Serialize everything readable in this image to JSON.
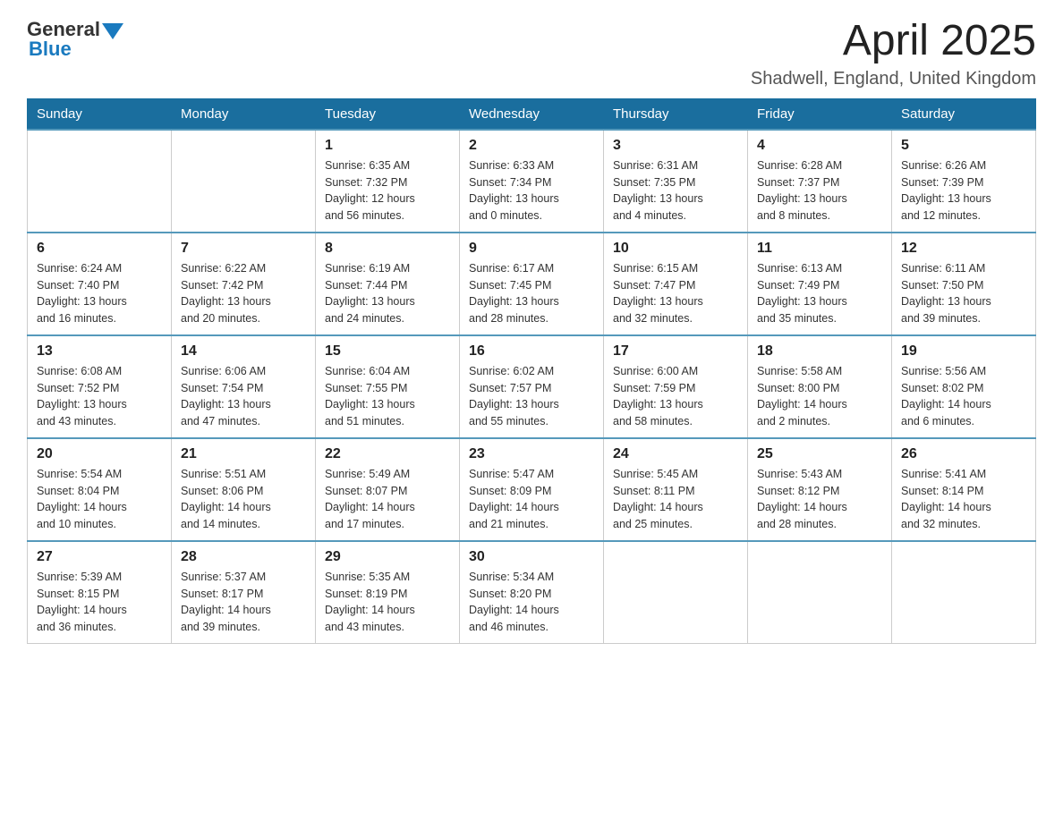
{
  "header": {
    "logo": {
      "general": "General",
      "blue": "Blue"
    },
    "title": "April 2025",
    "subtitle": "Shadwell, England, United Kingdom"
  },
  "calendar": {
    "days_of_week": [
      "Sunday",
      "Monday",
      "Tuesday",
      "Wednesday",
      "Thursday",
      "Friday",
      "Saturday"
    ],
    "weeks": [
      [
        {
          "day": "",
          "info": ""
        },
        {
          "day": "",
          "info": ""
        },
        {
          "day": "1",
          "info": "Sunrise: 6:35 AM\nSunset: 7:32 PM\nDaylight: 12 hours\nand 56 minutes."
        },
        {
          "day": "2",
          "info": "Sunrise: 6:33 AM\nSunset: 7:34 PM\nDaylight: 13 hours\nand 0 minutes."
        },
        {
          "day": "3",
          "info": "Sunrise: 6:31 AM\nSunset: 7:35 PM\nDaylight: 13 hours\nand 4 minutes."
        },
        {
          "day": "4",
          "info": "Sunrise: 6:28 AM\nSunset: 7:37 PM\nDaylight: 13 hours\nand 8 minutes."
        },
        {
          "day": "5",
          "info": "Sunrise: 6:26 AM\nSunset: 7:39 PM\nDaylight: 13 hours\nand 12 minutes."
        }
      ],
      [
        {
          "day": "6",
          "info": "Sunrise: 6:24 AM\nSunset: 7:40 PM\nDaylight: 13 hours\nand 16 minutes."
        },
        {
          "day": "7",
          "info": "Sunrise: 6:22 AM\nSunset: 7:42 PM\nDaylight: 13 hours\nand 20 minutes."
        },
        {
          "day": "8",
          "info": "Sunrise: 6:19 AM\nSunset: 7:44 PM\nDaylight: 13 hours\nand 24 minutes."
        },
        {
          "day": "9",
          "info": "Sunrise: 6:17 AM\nSunset: 7:45 PM\nDaylight: 13 hours\nand 28 minutes."
        },
        {
          "day": "10",
          "info": "Sunrise: 6:15 AM\nSunset: 7:47 PM\nDaylight: 13 hours\nand 32 minutes."
        },
        {
          "day": "11",
          "info": "Sunrise: 6:13 AM\nSunset: 7:49 PM\nDaylight: 13 hours\nand 35 minutes."
        },
        {
          "day": "12",
          "info": "Sunrise: 6:11 AM\nSunset: 7:50 PM\nDaylight: 13 hours\nand 39 minutes."
        }
      ],
      [
        {
          "day": "13",
          "info": "Sunrise: 6:08 AM\nSunset: 7:52 PM\nDaylight: 13 hours\nand 43 minutes."
        },
        {
          "day": "14",
          "info": "Sunrise: 6:06 AM\nSunset: 7:54 PM\nDaylight: 13 hours\nand 47 minutes."
        },
        {
          "day": "15",
          "info": "Sunrise: 6:04 AM\nSunset: 7:55 PM\nDaylight: 13 hours\nand 51 minutes."
        },
        {
          "day": "16",
          "info": "Sunrise: 6:02 AM\nSunset: 7:57 PM\nDaylight: 13 hours\nand 55 minutes."
        },
        {
          "day": "17",
          "info": "Sunrise: 6:00 AM\nSunset: 7:59 PM\nDaylight: 13 hours\nand 58 minutes."
        },
        {
          "day": "18",
          "info": "Sunrise: 5:58 AM\nSunset: 8:00 PM\nDaylight: 14 hours\nand 2 minutes."
        },
        {
          "day": "19",
          "info": "Sunrise: 5:56 AM\nSunset: 8:02 PM\nDaylight: 14 hours\nand 6 minutes."
        }
      ],
      [
        {
          "day": "20",
          "info": "Sunrise: 5:54 AM\nSunset: 8:04 PM\nDaylight: 14 hours\nand 10 minutes."
        },
        {
          "day": "21",
          "info": "Sunrise: 5:51 AM\nSunset: 8:06 PM\nDaylight: 14 hours\nand 14 minutes."
        },
        {
          "day": "22",
          "info": "Sunrise: 5:49 AM\nSunset: 8:07 PM\nDaylight: 14 hours\nand 17 minutes."
        },
        {
          "day": "23",
          "info": "Sunrise: 5:47 AM\nSunset: 8:09 PM\nDaylight: 14 hours\nand 21 minutes."
        },
        {
          "day": "24",
          "info": "Sunrise: 5:45 AM\nSunset: 8:11 PM\nDaylight: 14 hours\nand 25 minutes."
        },
        {
          "day": "25",
          "info": "Sunrise: 5:43 AM\nSunset: 8:12 PM\nDaylight: 14 hours\nand 28 minutes."
        },
        {
          "day": "26",
          "info": "Sunrise: 5:41 AM\nSunset: 8:14 PM\nDaylight: 14 hours\nand 32 minutes."
        }
      ],
      [
        {
          "day": "27",
          "info": "Sunrise: 5:39 AM\nSunset: 8:15 PM\nDaylight: 14 hours\nand 36 minutes."
        },
        {
          "day": "28",
          "info": "Sunrise: 5:37 AM\nSunset: 8:17 PM\nDaylight: 14 hours\nand 39 minutes."
        },
        {
          "day": "29",
          "info": "Sunrise: 5:35 AM\nSunset: 8:19 PM\nDaylight: 14 hours\nand 43 minutes."
        },
        {
          "day": "30",
          "info": "Sunrise: 5:34 AM\nSunset: 8:20 PM\nDaylight: 14 hours\nand 46 minutes."
        },
        {
          "day": "",
          "info": ""
        },
        {
          "day": "",
          "info": ""
        },
        {
          "day": "",
          "info": ""
        }
      ]
    ]
  }
}
